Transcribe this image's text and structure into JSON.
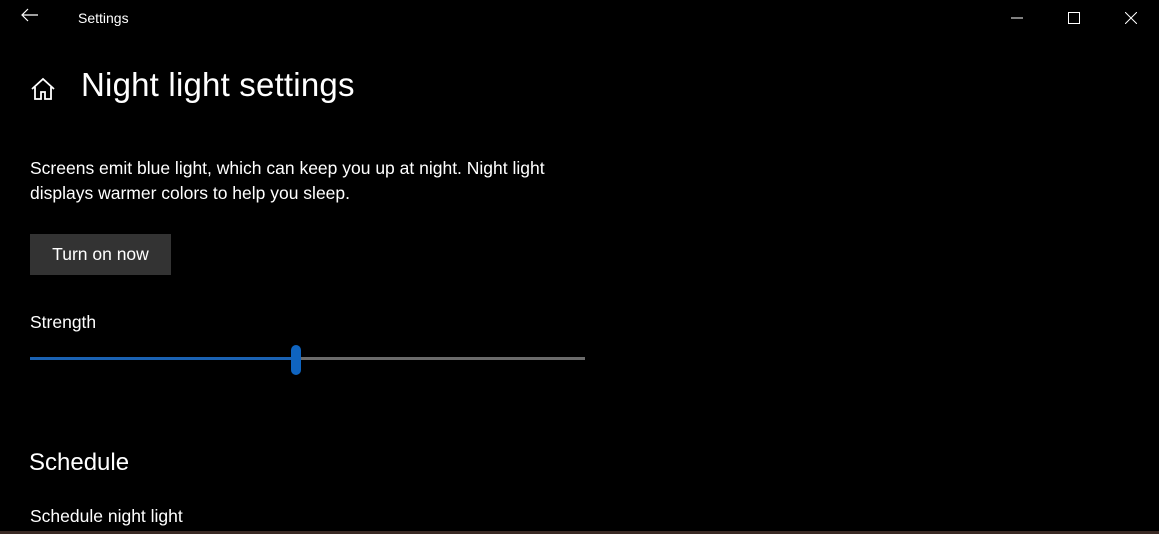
{
  "window": {
    "app_title": "Settings",
    "back_icon": "back-arrow-icon",
    "controls": [
      "minimize-icon",
      "maximize-icon",
      "close-icon"
    ]
  },
  "page": {
    "title": "Night light settings",
    "home_icon": "home-icon"
  },
  "description": "Screens emit blue light, which can keep you up at night. Night light displays warmer colors to help you sleep.",
  "turn_on_button": "Turn on now",
  "strength": {
    "label": "Strength",
    "value_percent": 48,
    "accent": "#0f64c0"
  },
  "schedule": {
    "heading": "Schedule",
    "label": "Schedule night light"
  }
}
